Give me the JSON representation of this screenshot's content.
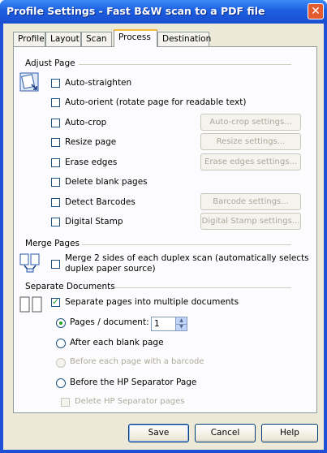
{
  "window": {
    "title": "Profile Settings - Fast B&W scan to a PDF file"
  },
  "tabs": [
    "Profile",
    "Layout",
    "Scan",
    "Process",
    "Destination"
  ],
  "adjust_page": {
    "heading": "Adjust Page",
    "auto_straighten": "Auto-straighten",
    "auto_orient": "Auto-orient (rotate page for readable text)",
    "auto_crop": "Auto-crop",
    "auto_crop_settings": "Auto-crop settings...",
    "resize_page": "Resize page",
    "resize_settings": "Resize settings...",
    "erase_edges": "Erase edges",
    "erase_edges_settings": "Erase edges settings...",
    "delete_blank": "Delete blank pages",
    "detect_barcodes": "Detect Barcodes",
    "barcode_settings": "Barcode settings...",
    "digital_stamp": "Digital Stamp",
    "digital_stamp_settings": "Digital Stamp settings..."
  },
  "merge_pages": {
    "heading": "Merge Pages",
    "merge_line1": "Merge 2 sides of each duplex scan (automatically selects",
    "merge_line2": "duplex paper source)"
  },
  "separate_documents": {
    "heading": "Separate Documents",
    "separate_label": "Separate pages into multiple documents",
    "pages_per_doc": "Pages / document:",
    "pages_value": "1",
    "after_blank": "After each blank page",
    "before_barcode": "Before each page with a barcode",
    "before_hp_sep": "Before the HP Separator Page",
    "delete_hp_sep": "Delete HP Separator pages"
  },
  "footer": {
    "save": "Save",
    "cancel": "Cancel",
    "help": "Help"
  }
}
